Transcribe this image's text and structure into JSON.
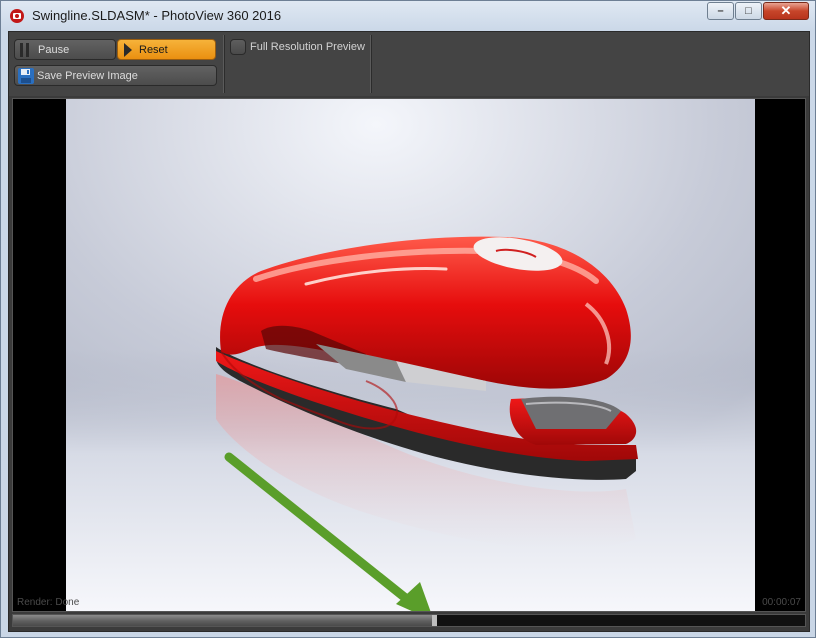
{
  "window": {
    "title": "Swingline.SLDASM* - PhotoView 360 2016",
    "controls": {
      "minimize": "–",
      "maximize": "□",
      "close": "✕"
    }
  },
  "toolbar": {
    "pause_label": "Pause",
    "reset_label": "Reset",
    "save_label": "Save Preview Image",
    "full_res_label": "Full Resolution Preview",
    "full_res_checked": false,
    "icons": {
      "pause": "pause-icon",
      "reset": "play-icon",
      "save": "floppy-disk-icon"
    }
  },
  "colors": {
    "reset_accent": "#f0a020",
    "stapler": "#e11010",
    "annotation_arrow": "#5a9e2a"
  },
  "status": {
    "left": "Render: Done",
    "right": "00:00:07"
  },
  "progress": {
    "fraction": 0.535
  }
}
